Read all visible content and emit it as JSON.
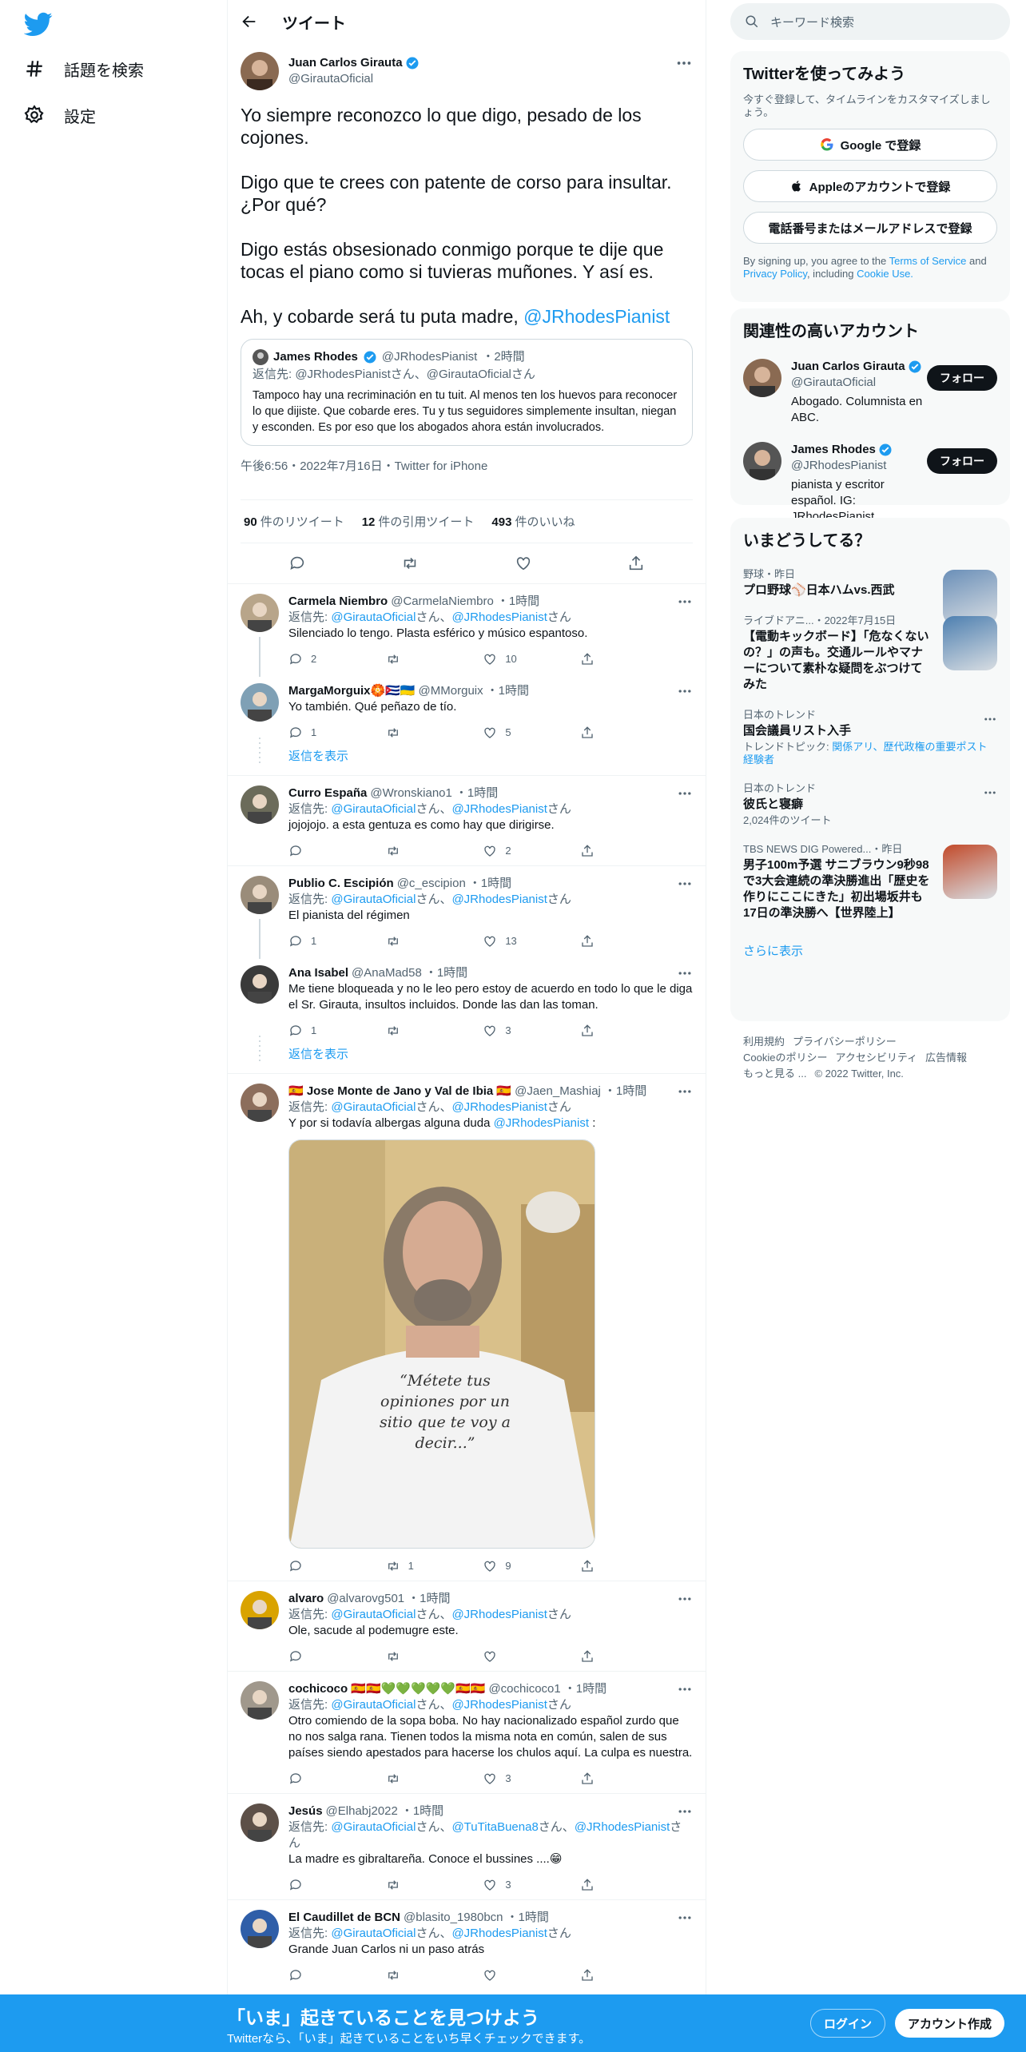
{
  "nav": {
    "explore_label": "話題を検索",
    "settings_label": "設定"
  },
  "header": {
    "title": "ツイート"
  },
  "main_tweet": {
    "author_name": "Juan Carlos Girauta",
    "author_handle": "@GirautaOficial",
    "text": "Yo siempre reconozco lo que digo, pesado de los cojones.\n\nDigo que te crees con patente de corso para insultar. ¿Por qué?\n\nDigo estás obsesionado conmigo porque te dije que tocas el piano como si tuvieras muñones. Y así es.\n\nAh, y cobarde será tu puta madre, ",
    "mention": "@JRhodesPianist",
    "quote": {
      "author_name": "James Rhodes",
      "author_handle": "@JRhodesPianist",
      "time": "・2時間",
      "reply_to": "返信先: @JRhodesPianistさん、@GirautaOficialさん",
      "text": "Tampoco hay una recriminación  en tu tuit. Al menos ten los huevos para reconocer lo que dijiste. Que cobarde eres. Tu y tus seguidores simplemente insultan, niegan y esconden. Es por eso que los abogados ahora están involucrados."
    },
    "timestamp": "午後6:56・2022年7月16日・Twitter for iPhone",
    "stats": {
      "retweets_count": "90",
      "retweets_label": "件のリツイート",
      "quotes_count": "12",
      "quotes_label": "件の引用ツイート",
      "likes_count": "493",
      "likes_label": "件のいいね"
    }
  },
  "reply_prefix": "返信先: ",
  "san": "さん",
  "comma": "、",
  "show_replies": "返信を表示",
  "replies": [
    {
      "name": "Carmela Niembro",
      "handle": "@CarmelaNiembro",
      "time": "・1時間",
      "reply_to": [
        "@GirautaOficial",
        "@JRhodesPianist"
      ],
      "text": "Silenciado lo tengo. Plasta esférico y músico espantoso.",
      "replies": "2",
      "retweets": "",
      "likes": "10"
    },
    {
      "name": "MargaMorguix🏵️🇨🇺🇺🇦",
      "handle": "@MMorguix",
      "time": "・1時間",
      "text": "Yo también. Qué peñazo de tío.",
      "replies": "1",
      "retweets": "",
      "likes": "5"
    },
    {
      "name": "Curro España",
      "handle": "@Wronskiano1",
      "time": "・1時間",
      "reply_to": [
        "@GirautaOficial",
        "@JRhodesPianist"
      ],
      "text": "jojojojo. a esta gentuza es como hay que dirigirse.",
      "replies": "",
      "retweets": "",
      "likes": "2"
    },
    {
      "name": "Publio C. Escipión",
      "handle": "@c_escipion",
      "time": "・1時間",
      "reply_to": [
        "@GirautaOficial",
        "@JRhodesPianist"
      ],
      "text": "El pianista del régimen",
      "replies": "1",
      "retweets": "",
      "likes": "13"
    },
    {
      "name": "Ana Isabel",
      "handle": "@AnaMad58",
      "time": "・1時間",
      "text": "Me tiene bloqueada y no le leo pero estoy de acuerdo en todo lo que le diga el Sr. Girauta, insultos incluidos. Donde las dan las toman.",
      "replies": "1",
      "retweets": "",
      "likes": "3"
    },
    {
      "name": "🇪🇸 Jose Monte de Jano y Val de Ibia 🇪🇸",
      "handle": "@Jaen_Mashiaj",
      "time": "・1時間",
      "reply_to": [
        "@GirautaOficial",
        "@JRhodesPianist"
      ],
      "text": "Y por si todavía albergas alguna duda ",
      "text_mention": "@JRhodesPianist",
      "text_tail": " :",
      "image_caption": "“Métete tus opiniones por un sitio que te voy a decir...”",
      "replies": "",
      "retweets": "1",
      "likes": "9"
    },
    {
      "name": "alvaro",
      "handle": "@alvarovg501",
      "time": "・1時間",
      "reply_to": [
        "@GirautaOficial",
        "@JRhodesPianist"
      ],
      "text": "Ole, sacude al podemugre este.",
      "replies": "",
      "retweets": "",
      "likes": ""
    },
    {
      "name": "cochicoco 🇪🇸🇪🇸💚💚💚💚💚🇪🇸🇪🇸",
      "handle": "@cochicoco1",
      "time": "・1時間",
      "reply_to": [
        "@GirautaOficial",
        "@JRhodesPianist"
      ],
      "text": "Otro comiendo de la sopa boba. No hay nacionalizado español zurdo que no nos salga rana. Tienen todos la misma nota en común, salen de sus países siendo apestados para hacerse los chulos aquí. La culpa es nuestra.",
      "replies": "",
      "retweets": "",
      "likes": "3"
    },
    {
      "name": "Jesús",
      "handle": "@Elhabj2022",
      "time": "・1時間",
      "reply_to": [
        "@GirautaOficial",
        "@TuTitaBuena8",
        "@JRhodesPianist"
      ],
      "text": "La madre es gibraltareña. Conoce el bussines ....😁",
      "replies": "",
      "retweets": "",
      "likes": "3"
    },
    {
      "name": "El Caudillet de BCN",
      "handle": "@blasito_1980bcn",
      "time": "・1時間",
      "reply_to": [
        "@GirautaOficial",
        "@JRhodesPianist"
      ],
      "text": "Grande Juan Carlos ni un paso atrás",
      "replies": "",
      "retweets": "",
      "likes": ""
    }
  ],
  "right": {
    "search_placeholder": "キーワード検索",
    "signup": {
      "title": "Twitterを使ってみよう",
      "desc": "今すぐ登録して、タイムラインをカスタマイズしましょう。",
      "google_btn": "Google で登録",
      "apple_btn": "Appleのアカウントで登録",
      "phone_btn": "電話番号またはメールアドレスで登録",
      "terms_pre": "By signing up, you agree to the ",
      "terms_tos": "Terms of Service",
      "terms_and": " and ",
      "terms_privacy": "Privacy Policy",
      "terms_incl": ", including ",
      "terms_cookie": "Cookie Use."
    },
    "related": {
      "title": "関連性の高いアカウント",
      "follow_label": "フォロー",
      "accounts": [
        {
          "name": "Juan Carlos Girauta",
          "handle": "@GirautaOficial",
          "bio": "Abogado. Columnista en ABC."
        },
        {
          "name": "James Rhodes",
          "handle": "@JRhodesPianist",
          "bio": "pianista y escritor español. IG: JRhodesPianist"
        }
      ]
    },
    "trends": {
      "title": "いまどうしてる？",
      "items": [
        {
          "category": "野球・昨日",
          "title": "プロ野球⚾日本ハムvs.西武"
        },
        {
          "category": "ライブドアニ...・2022年7月15日",
          "title": "【電動キックボード】「危なくないの？」の声も。交通ルールやマナーについて素朴な疑問をぶつけてみた"
        },
        {
          "category": "日本のトレンド",
          "title": "国会議員リスト入手",
          "sub_pre": "トレンドトピック: ",
          "sub_links": "関係アリ、歴代政権の重要ポスト経験者"
        },
        {
          "category": "日本のトレンド",
          "title": "彼氏と寝癖",
          "sub": "2,024件のツイート"
        },
        {
          "category": "TBS NEWS DIG Powered...・昨日",
          "title": "男子100m予選 サニブラウン9秒98で3大会連続の準決勝進出「歴史を作りにここにきた」初出場坂井も17日の準決勝へ【世界陸上】"
        }
      ],
      "show_more": "さらに表示"
    },
    "footer": [
      "利用規約",
      "プライバシーポリシー",
      "Cookieのポリシー",
      "アクセシビリティ",
      "広告情報",
      "もっと見る ...",
      "© 2022 Twitter, Inc."
    ]
  },
  "bottom_bar": {
    "title": "「いま」起きていることを見つけよう",
    "subtitle": "Twitterなら、「いま」起きていることをいち早くチェックできます。",
    "login": "ログイン",
    "signup": "アカウント作成"
  },
  "colors": {
    "accent": "#1d9bf0",
    "text": "#0f1419",
    "secondary": "#536471",
    "border": "#eff3f4"
  }
}
